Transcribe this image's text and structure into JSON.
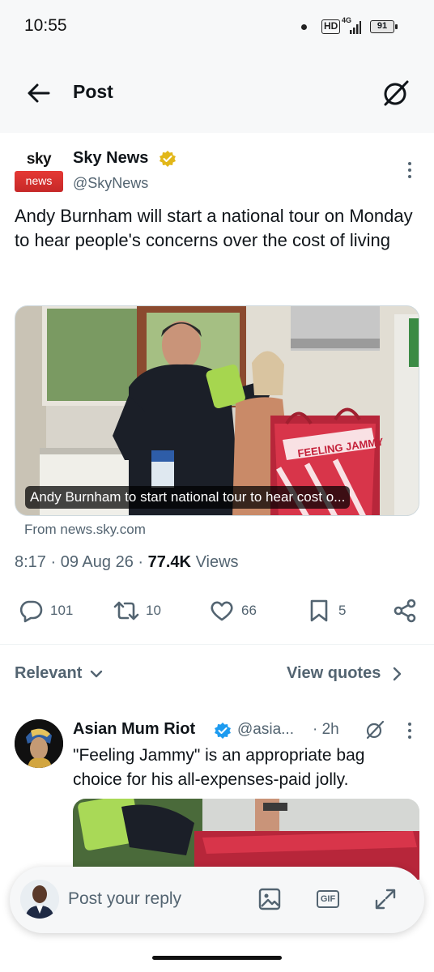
{
  "status_bar": {
    "time": "10:55",
    "hd_label": "HD",
    "network": "4G",
    "battery": "91"
  },
  "header": {
    "title": "Post",
    "back_icon": "arrow-left-icon",
    "grok_icon": "grok-icon"
  },
  "post": {
    "author_name": "Sky News",
    "author_handle": "@SkyNews",
    "avatar_sky_text": "sky",
    "avatar_news_text": "news",
    "text": "Andy Burnham will start a national tour on Monday to hear people's concerns over the cost of living",
    "card_caption": "Andy Burnham to start national tour to hear cost o...",
    "bag_text": "FEELING JAMMY",
    "link_source": "From news.sky.com",
    "time": "8:17",
    "date": "09 Aug 26",
    "views_count": "77.4K",
    "views_label": "Views",
    "actions": {
      "replies": "101",
      "reposts": "10",
      "likes": "66",
      "bookmarks": "5"
    }
  },
  "sort": {
    "relevant_label": "Relevant",
    "view_quotes_label": "View quotes"
  },
  "reply": {
    "author_name": "Asian Mum Riot",
    "author_handle": "@asia...",
    "time": "· 2h",
    "text": "\"Feeling Jammy\" is an appropriate bag choice for his all-expenses-paid jolly."
  },
  "composer": {
    "placeholder": "Post your reply",
    "gif_label": "GIF"
  },
  "colors": {
    "verified_gold": "#e2b719",
    "verified_blue": "#1d9bf0",
    "secondary_text": "#536471",
    "sky_red": "#e53935"
  }
}
